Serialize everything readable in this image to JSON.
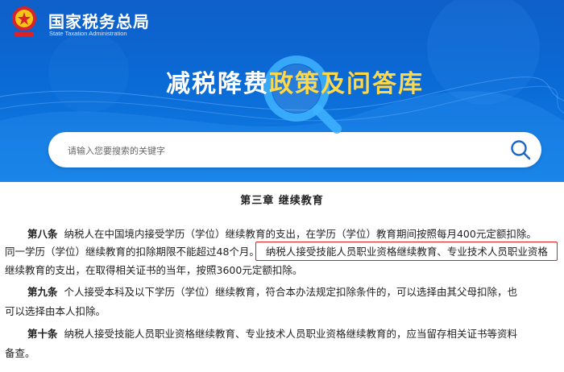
{
  "header": {
    "org_name": "国家税务总局",
    "org_name_en": "State Taxation Administration",
    "hero_title_part1": "减税降费",
    "hero_title_part2": "政策及问答库"
  },
  "search": {
    "placeholder": "请输入您要搜索的关键字",
    "button_icon": "search-icon"
  },
  "article": {
    "chapter_title": "第三章   继续教育",
    "art8": {
      "label": "第八条",
      "line1": "纳税人在中国境内接受学历（学位）继续教育的支出，在学历（学位）教育期间按照每月400元定额扣除。",
      "line2a": "同一学历（学位）继续教育的扣除期限不能超过48个月。",
      "line2_highlight": "纳税人接受技能人员职业资格继续教育、专业技术人员职业资格",
      "line3": "继续教育的支出，在取得相关证书的当年，按照3600元定额扣除。"
    },
    "art9": {
      "label": "第九条",
      "line1": "个人接受本科及以下学历（学位）继续教育，符合本办法规定扣除条件的，可以选择由其父母扣除，也",
      "line2": "可以选择由本人扣除。"
    },
    "art10": {
      "label": "第十条",
      "line1": "纳税人接受技能人员职业资格继续教育、专业技术人员职业资格继续教育的，应当留存相关证书等资料",
      "line2": "备查。"
    }
  },
  "colors": {
    "banner_blue": "#0a6ad6",
    "accent_yellow": "#ffd84a",
    "highlight_red": "#e0201c"
  }
}
